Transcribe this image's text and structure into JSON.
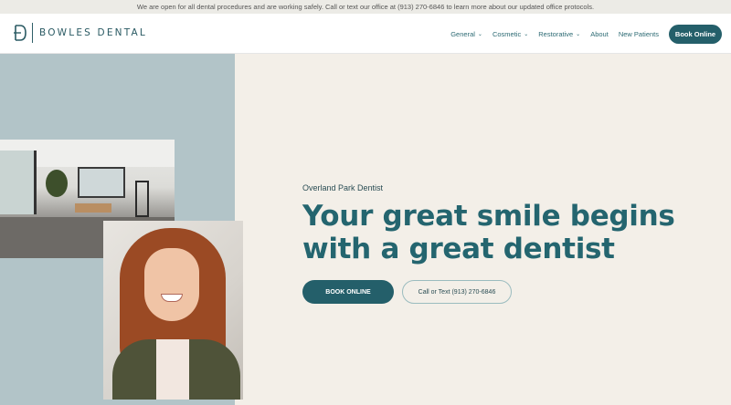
{
  "announcement": "We are open for all dental procedures and are working safely. Call or text our office at (913) 270-6846 to learn more about our updated office protocols.",
  "header": {
    "brand": "BOWLES DENTAL",
    "nav": [
      {
        "label": "General",
        "has_dropdown": true
      },
      {
        "label": "Cosmetic",
        "has_dropdown": true
      },
      {
        "label": "Restorative",
        "has_dropdown": true
      },
      {
        "label": "About",
        "has_dropdown": false
      },
      {
        "label": "New Patients",
        "has_dropdown": false
      }
    ],
    "chevron": "⌄",
    "book_button": "Book Online"
  },
  "hero": {
    "eyebrow": "Overland Park Dentist",
    "headline": "Your great smile begins with a great dentist",
    "primary_cta": "BOOK ONLINE",
    "secondary_cta": "Call or Text (913) 270-6846"
  },
  "colors": {
    "brand_teal": "#245f6a",
    "headline_teal": "#24656f",
    "left_panel": "#b2c4c8",
    "page_bg": "#f3efe8"
  },
  "icons": {
    "logo": "bowles-dental-logo-mark"
  }
}
